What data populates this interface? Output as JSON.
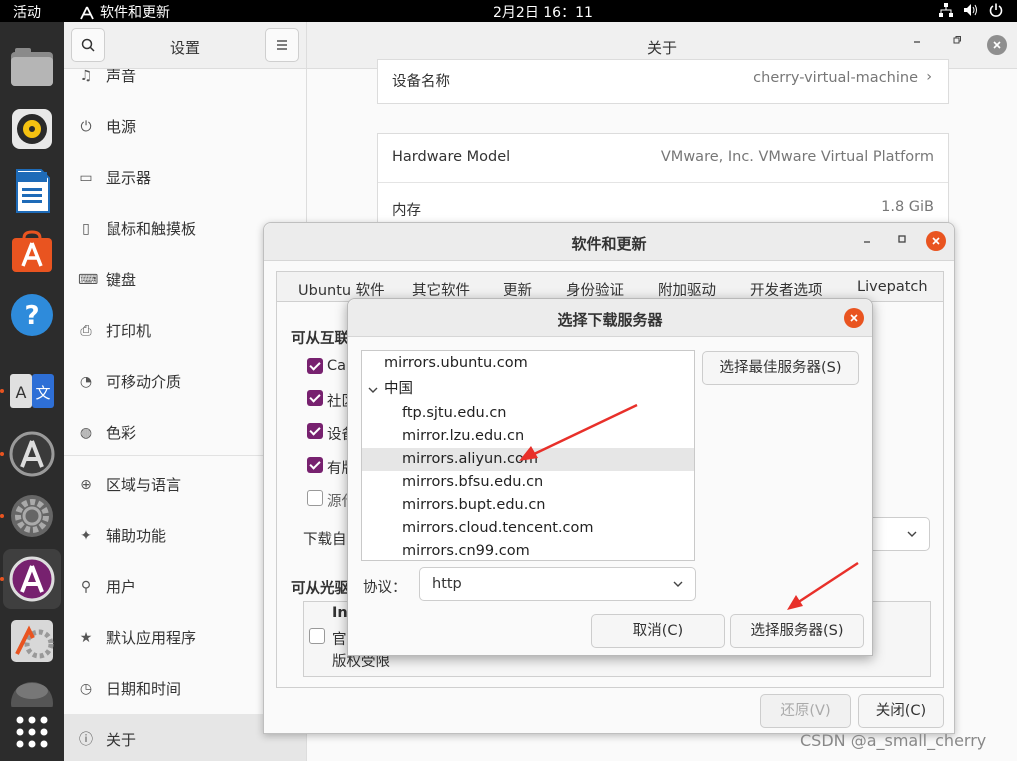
{
  "topbar": {
    "activities": "活动",
    "app_name": "软件和更新",
    "clock": "2月2日  16：11"
  },
  "dock": {
    "items": [
      "files-icon",
      "rhythmbox-icon",
      "writer-icon",
      "software-icon",
      "help-icon",
      "language-icon",
      "software-updater-icon",
      "settings-icon",
      "software-properties-icon",
      "update-manager-icon",
      "trash-icon",
      "apps-grid-icon"
    ]
  },
  "settings": {
    "sidebar_title": "设置",
    "main_title": "关于",
    "sidebar": [
      {
        "icon": "sound-icon",
        "label": "声音"
      },
      {
        "icon": "power-icon",
        "label": "电源"
      },
      {
        "icon": "display-icon",
        "label": "显示器"
      },
      {
        "icon": "mouse-icon",
        "label": "鼠标和触摸板"
      },
      {
        "icon": "keyboard-icon",
        "label": "键盘"
      },
      {
        "icon": "printer-icon",
        "label": "打印机"
      },
      {
        "icon": "removable-media-icon",
        "label": "可移动介质"
      },
      {
        "icon": "color-icon",
        "label": "色彩"
      },
      {
        "icon": "region-icon",
        "label": "区域与语言"
      },
      {
        "icon": "accessibility-icon",
        "label": "辅助功能"
      },
      {
        "icon": "users-icon",
        "label": "用户"
      },
      {
        "icon": "default-apps-icon",
        "label": "默认应用程序"
      },
      {
        "icon": "datetime-icon",
        "label": "日期和时间"
      },
      {
        "icon": "about-icon",
        "label": "关于"
      }
    ],
    "device_name_label": "设备名称",
    "device_name_value": "cherry-virtual-machine",
    "hardware_model_label": "Hardware Model",
    "hardware_model_value": "VMware, Inc. VMware Virtual Platform",
    "memory_label": "内存",
    "memory_value": "1.8 GiB"
  },
  "software_window": {
    "title": "软件和更新",
    "tabs": [
      "Ubuntu 软件",
      "其它软件",
      "更新",
      "身份验证",
      "附加驱动",
      "开发者选项",
      "Livepatch"
    ],
    "section_internet": "可从互联",
    "checks": [
      {
        "label": "Can",
        "checked": true
      },
      {
        "label": "社区",
        "checked": true
      },
      {
        "label": "设备",
        "checked": true
      },
      {
        "label": "有版",
        "checked": true
      },
      {
        "label": "源代",
        "checked": false
      }
    ],
    "download_from_label": "下载自",
    "section_cdrom": "可从光驱",
    "cdrom_title": "Ins",
    "cdrom_line1": "官",
    "cdrom_line2": "版权受限",
    "revert_label": "还原(V)",
    "close_label": "关闭(C)"
  },
  "dialog": {
    "title": "选择下载服务器",
    "servers_top": "mirrors.ubuntu.com",
    "group_label": "中国",
    "servers": [
      "ftp.sjtu.edu.cn",
      "mirror.lzu.edu.cn",
      "mirrors.aliyun.com",
      "mirrors.bfsu.edu.cn",
      "mirrors.bupt.edu.cn",
      "mirrors.cloud.tencent.com",
      "mirrors.cn99.com"
    ],
    "selected_server": "mirrors.aliyun.com",
    "best_server_label": "选择最佳服务器(S)",
    "protocol_label": "协议：",
    "protocol_value": "http",
    "cancel_label": "取消(C)",
    "choose_label": "选择服务器(S)"
  },
  "watermark": "CSDN @a_small_cherry",
  "colors": {
    "accent": "#e95420",
    "check": "#77216f",
    "arrow": "#e8302a",
    "dock": "#2c2c2c"
  }
}
